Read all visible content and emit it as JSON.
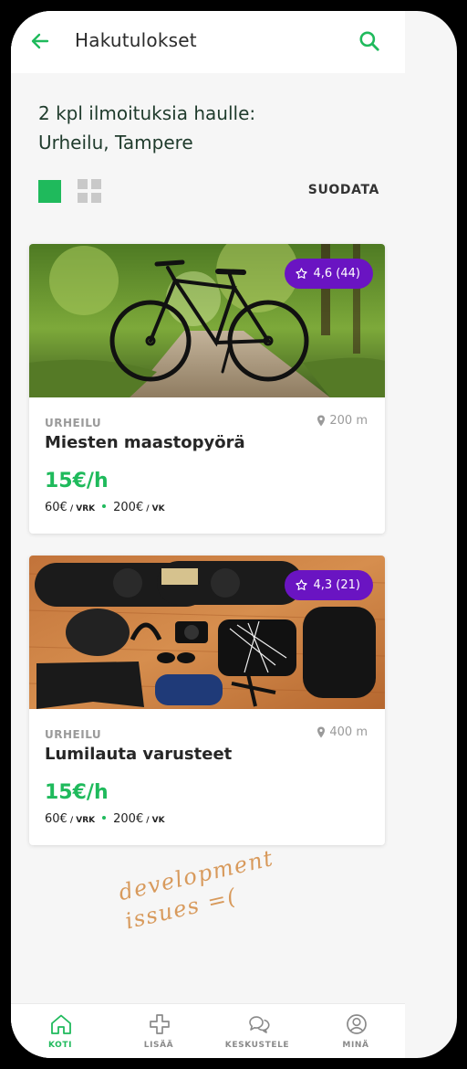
{
  "topbar": {
    "title": "Hakutulokset",
    "back_icon": "arrow-left-icon",
    "search_icon": "search-icon"
  },
  "results": {
    "heading_line1": "2 kpl ilmoituksia haulle:",
    "heading_line2": "Urheilu, Tampere"
  },
  "view_toggle": {
    "list_icon": "list-view-icon",
    "grid_icon": "grid-view-icon",
    "active": "list"
  },
  "filter_label": "SUODATA",
  "listings": [
    {
      "category": "URHEILU",
      "title": "Miesten maastopyörä",
      "distance": "200 m",
      "rating": "4,6 (44)",
      "price": "15€/h",
      "day_price": "60€",
      "day_unit": "/ VRK",
      "week_price": "200€",
      "week_unit": "/ VK",
      "image": "mountain-bike-photo"
    },
    {
      "category": "URHEILU",
      "title": "Lumilauta varusteet",
      "distance": "400 m",
      "rating": "4,3 (21)",
      "price": "15€/h",
      "day_price": "60€",
      "day_unit": "/ VRK",
      "week_price": "200€",
      "week_unit": "/ VK",
      "image": "snowboard-gear-photo"
    }
  ],
  "annotation": {
    "line1": "development",
    "line2": "issues =("
  },
  "bottom_nav": [
    {
      "label": "KOTI",
      "icon": "home-icon",
      "active": true
    },
    {
      "label": "LISÄÄ",
      "icon": "plus-icon",
      "active": false
    },
    {
      "label": "KESKUSTELE",
      "icon": "chat-icon",
      "active": false
    },
    {
      "label": "MINÄ",
      "icon": "profile-icon",
      "active": false
    }
  ],
  "colors": {
    "accent": "#1fba5c",
    "badge": "#6a14c2",
    "heading": "#1f3b2c",
    "annotation": "#d89a5c"
  }
}
